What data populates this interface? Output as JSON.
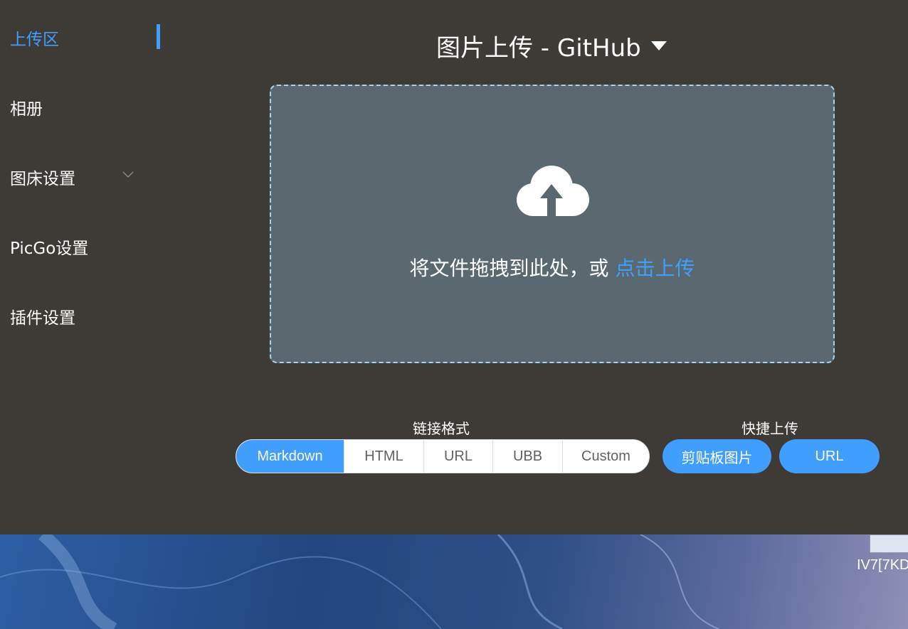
{
  "sidebar": {
    "items": [
      {
        "label": "上传区",
        "active": true
      },
      {
        "label": "相册"
      },
      {
        "label": "图床设置",
        "has_submenu": true
      },
      {
        "label": "PicGo设置"
      },
      {
        "label": "插件设置"
      }
    ]
  },
  "header": {
    "title": "图片上传 - GitHub",
    "dropdown_icon": "caret-down-icon"
  },
  "upload": {
    "icon": "cloud-upload-icon",
    "text": "将文件拖拽到此处，或",
    "link": "点击上传"
  },
  "link_format": {
    "label": "链接格式",
    "options": [
      "Markdown",
      "HTML",
      "URL",
      "UBB",
      "Custom"
    ],
    "selected": "Markdown"
  },
  "quick_upload": {
    "label": "快捷上传",
    "clipboard_button": "剪贴板图片",
    "url_button": "URL"
  },
  "desktop": {
    "icon_label": "IV7[7KD"
  },
  "colors": {
    "accent": "#409eff",
    "background": "#3e3a36",
    "dropzone": "#5a6870"
  }
}
